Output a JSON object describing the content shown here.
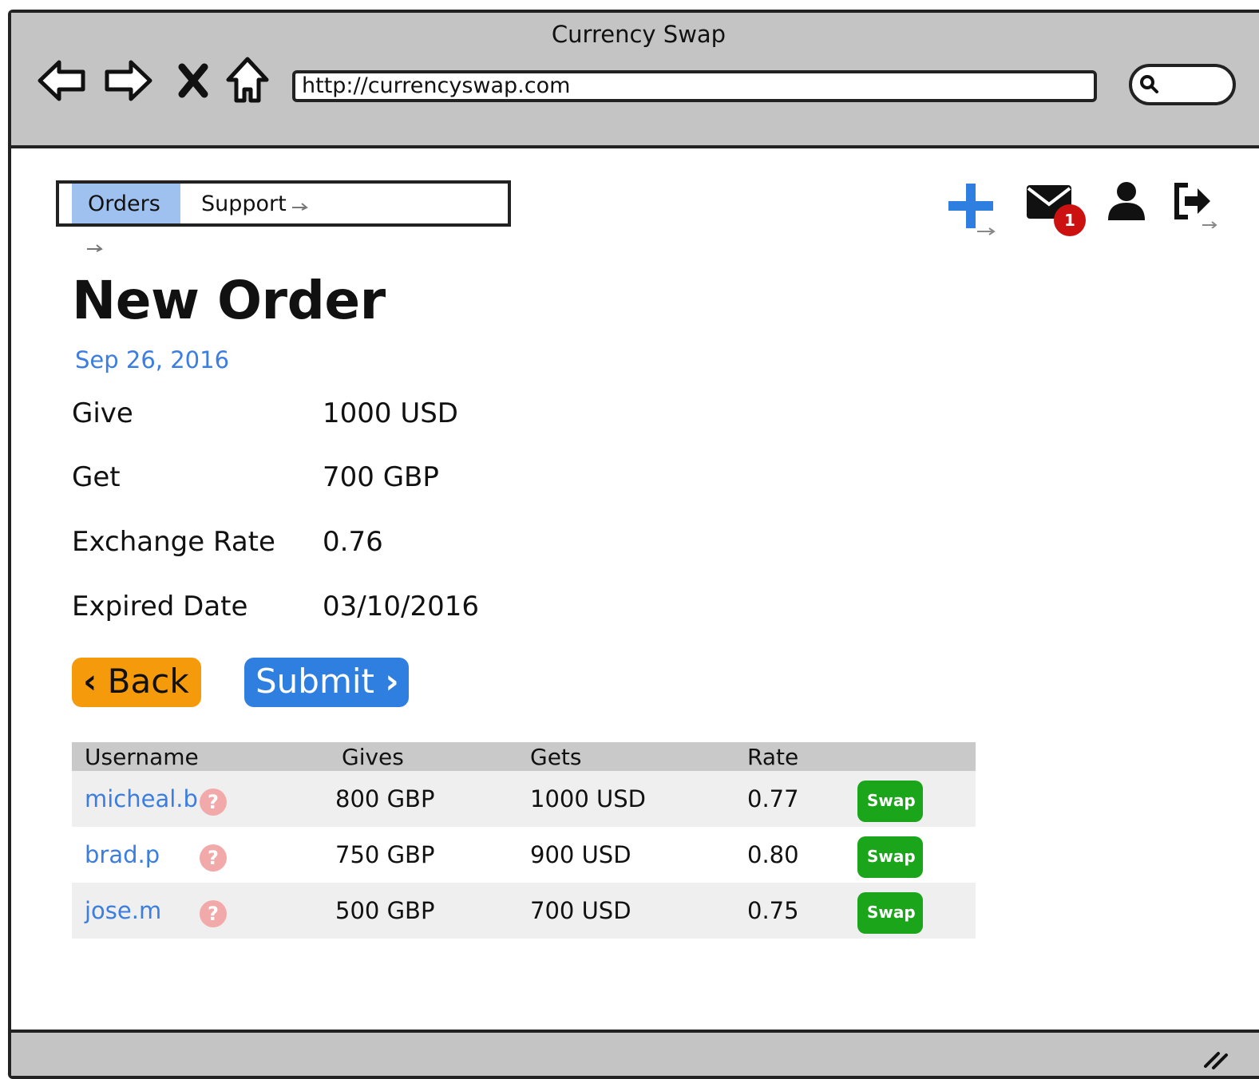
{
  "browser": {
    "title": "Currency Swap",
    "url": "http://currencyswap.com",
    "nav_icons": [
      "back-arrow-icon",
      "forward-arrow-icon",
      "close-icon",
      "home-icon"
    ]
  },
  "tabs": [
    {
      "label": "Orders",
      "active": true
    },
    {
      "label": "Support",
      "active": false
    }
  ],
  "toolbar": {
    "icons": [
      "add-icon",
      "mail-icon",
      "user-icon",
      "sign-out-icon"
    ],
    "mail_badge": "1",
    "accent_color": "#2f7fe0"
  },
  "order": {
    "title": "New Order",
    "date": "Sep 26, 2016",
    "fields": [
      {
        "label": "Give",
        "value": "1000 USD"
      },
      {
        "label": "Get",
        "value": "700 GBP"
      },
      {
        "label": "Exchange Rate",
        "value": "0.76"
      },
      {
        "label": "Expired Date",
        "value": "03/10/2016"
      }
    ]
  },
  "actions": {
    "back_label": "Back",
    "submit_label": "Submit",
    "back_color": "#f59a0a",
    "submit_color": "#2f7fe0"
  },
  "offers": {
    "headers": [
      "Username",
      "Gives",
      "Gets",
      "Rate"
    ],
    "swap_label": "Swap",
    "rows": [
      {
        "username": "micheal.b",
        "gives": "800 GBP",
        "gets": "1000 USD",
        "rate": "0.77"
      },
      {
        "username": "brad.p",
        "gives": "750 GBP",
        "gets": "900 USD",
        "rate": "0.80"
      },
      {
        "username": "jose.m",
        "gives": "500 GBP",
        "gets": "700 USD",
        "rate": "0.75"
      }
    ]
  }
}
